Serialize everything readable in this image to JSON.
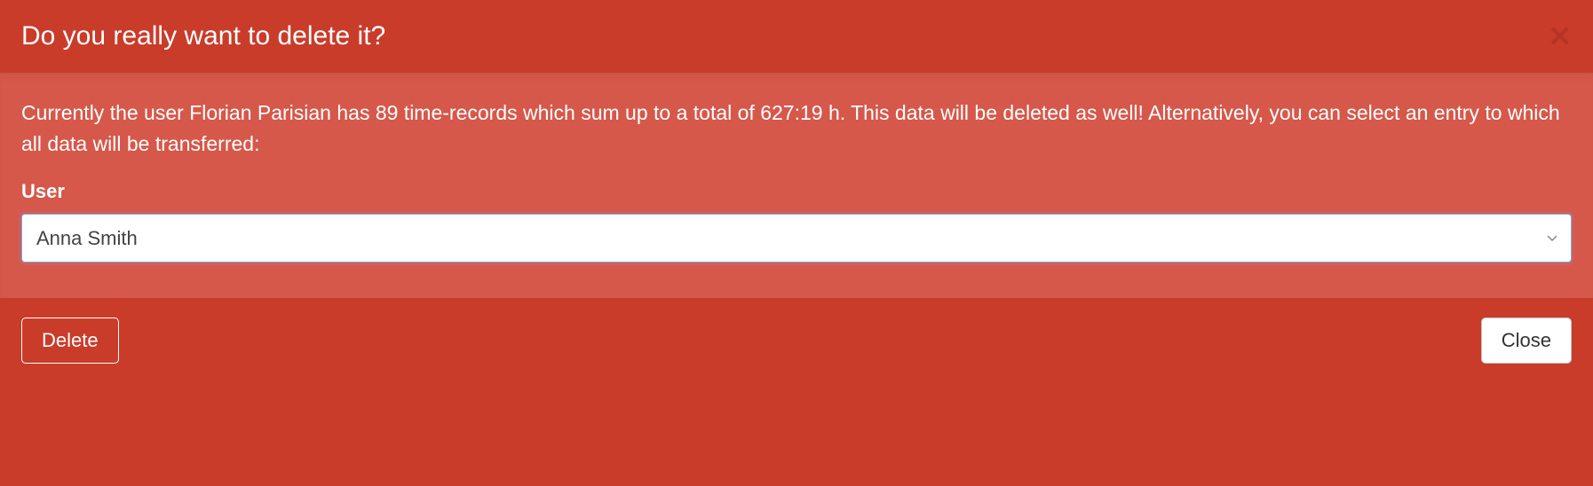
{
  "header": {
    "title": "Do you really want to delete it?"
  },
  "body": {
    "message": "Currently the user Florian Parisian has 89 time-records which sum up to a total of 627:19 h. This data will be deleted as well! Alternatively, you can select an entry to which all data will be transferred:",
    "user_label": "User",
    "user_selected": "Anna Smith"
  },
  "footer": {
    "delete_label": "Delete",
    "close_label": "Close"
  }
}
